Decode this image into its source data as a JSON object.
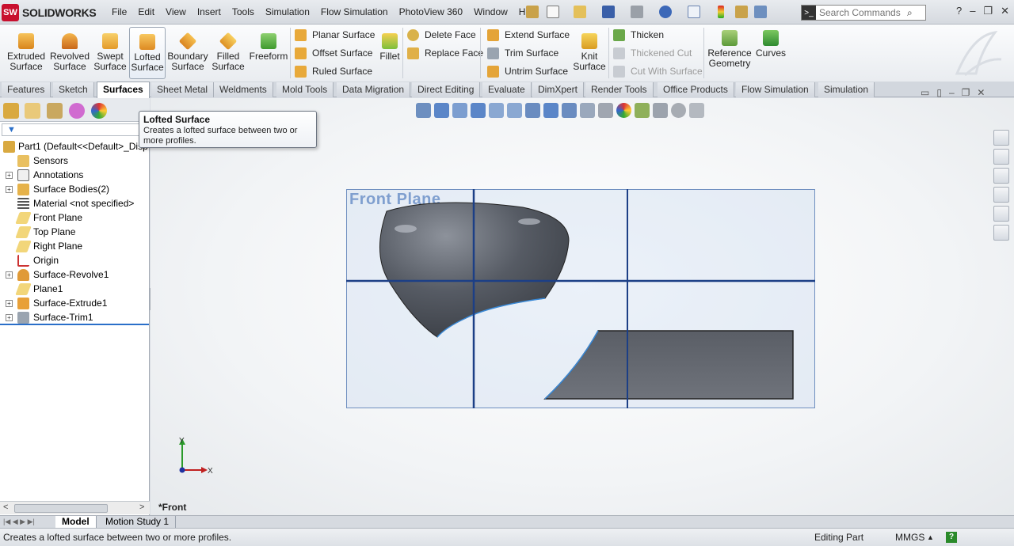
{
  "app": {
    "name": "SOLIDWORKS",
    "logo_mark": "SW"
  },
  "menu": [
    "File",
    "Edit",
    "View",
    "Insert",
    "Tools",
    "Simulation",
    "Flow Simulation",
    "PhotoView 360",
    "Window",
    "Help"
  ],
  "search": {
    "placeholder": "Search Commands"
  },
  "ribbon": {
    "big": [
      {
        "label1": "Extruded",
        "label2": "Surface",
        "icon": "extruded-surface-icon"
      },
      {
        "label1": "Revolved",
        "label2": "Surface",
        "icon": "revolved-surface-icon"
      },
      {
        "label1": "Swept",
        "label2": "Surface",
        "icon": "swept-surface-icon"
      },
      {
        "label1": "Lofted",
        "label2": "Surface",
        "icon": "lofted-surface-icon"
      },
      {
        "label1": "Boundary",
        "label2": "Surface",
        "icon": "boundary-surface-icon"
      },
      {
        "label1": "Filled",
        "label2": "Surface",
        "icon": "filled-surface-icon"
      },
      {
        "label1": "Freeform",
        "label2": "",
        "icon": "freeform-icon"
      }
    ],
    "small1": [
      "Planar Surface",
      "Offset Surface",
      "Ruled Surface"
    ],
    "fillet": "Fillet",
    "small2": [
      "Delete Face",
      "Replace Face"
    ],
    "small3": [
      "Extend Surface",
      "Trim Surface",
      "Untrim Surface"
    ],
    "knit": {
      "label1": "Knit",
      "label2": "Surface"
    },
    "small4": [
      "Thicken",
      "Thickened Cut",
      "Cut With Surface"
    ],
    "refgeo": {
      "label1": "Reference",
      "label2": "Geometry"
    },
    "curves": "Curves"
  },
  "tabs": [
    "Features",
    "Sketch",
    "Surfaces",
    "Sheet Metal",
    "Weldments",
    "Mold Tools",
    "Data Migration",
    "Direct Editing",
    "Evaluate",
    "DimXpert",
    "Render Tools",
    "Office Products",
    "Flow Simulation",
    "Simulation"
  ],
  "tree": [
    {
      "label": "Part1  (Default<<Default>_Disp",
      "exp": false
    },
    {
      "label": "Sensors",
      "exp": false
    },
    {
      "label": "Annotations",
      "exp": true
    },
    {
      "label": "Surface Bodies(2)",
      "exp": true
    },
    {
      "label": "Material <not specified>",
      "exp": false
    },
    {
      "label": "Front Plane",
      "exp": false
    },
    {
      "label": "Top Plane",
      "exp": false
    },
    {
      "label": "Right Plane",
      "exp": false
    },
    {
      "label": "Origin",
      "exp": false
    },
    {
      "label": "Surface-Revolve1",
      "exp": true
    },
    {
      "label": "Plane1",
      "exp": false
    },
    {
      "label": "Surface-Extrude1",
      "exp": true
    },
    {
      "label": "Surface-Trim1",
      "exp": true
    }
  ],
  "tooltip": {
    "title": "Lofted Surface",
    "desc": "Creates a lofted surface between two or more profiles."
  },
  "viewport": {
    "plane_label": "Front Plane",
    "view_name": "*Front",
    "axis_x": "X",
    "axis_y": "Y"
  },
  "bottom_tabs": [
    "Model",
    "Motion Study 1"
  ],
  "status": {
    "message": "Creates a lofted surface between two or more profiles.",
    "mode": "Editing Part",
    "units": "MMGS",
    "units_arrow": "▲",
    "help": "?"
  },
  "colors": {
    "accent": "#2a6fc9",
    "plane_border": "#6f8fc0",
    "surface_dark": "#4a4e56"
  }
}
